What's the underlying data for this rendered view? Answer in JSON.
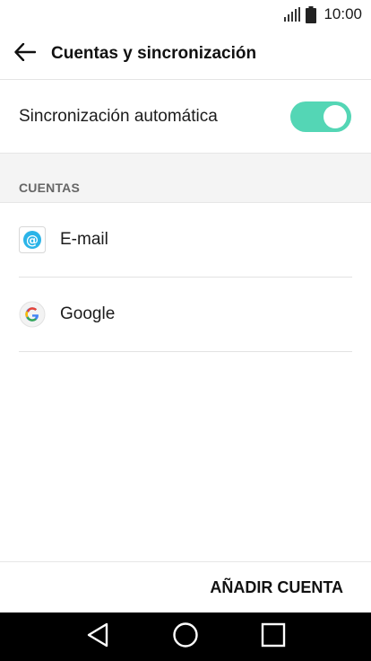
{
  "status_bar": {
    "time": "10:00"
  },
  "header": {
    "title": "Cuentas y sincronización",
    "back_icon": "arrow-left-icon"
  },
  "auto_sync": {
    "label": "Sincronización automática",
    "enabled": true,
    "accent_color": "#54d6b5"
  },
  "section": {
    "title": "CUENTAS"
  },
  "accounts": [
    {
      "label": "E-mail",
      "icon": "email-at-icon"
    },
    {
      "label": "Google",
      "icon": "google-g-icon"
    }
  ],
  "actions": {
    "add_account": "AÑADIR CUENTA"
  },
  "nav": {
    "back": "nav-back-icon",
    "home": "nav-home-icon",
    "recents": "nav-recents-icon"
  }
}
